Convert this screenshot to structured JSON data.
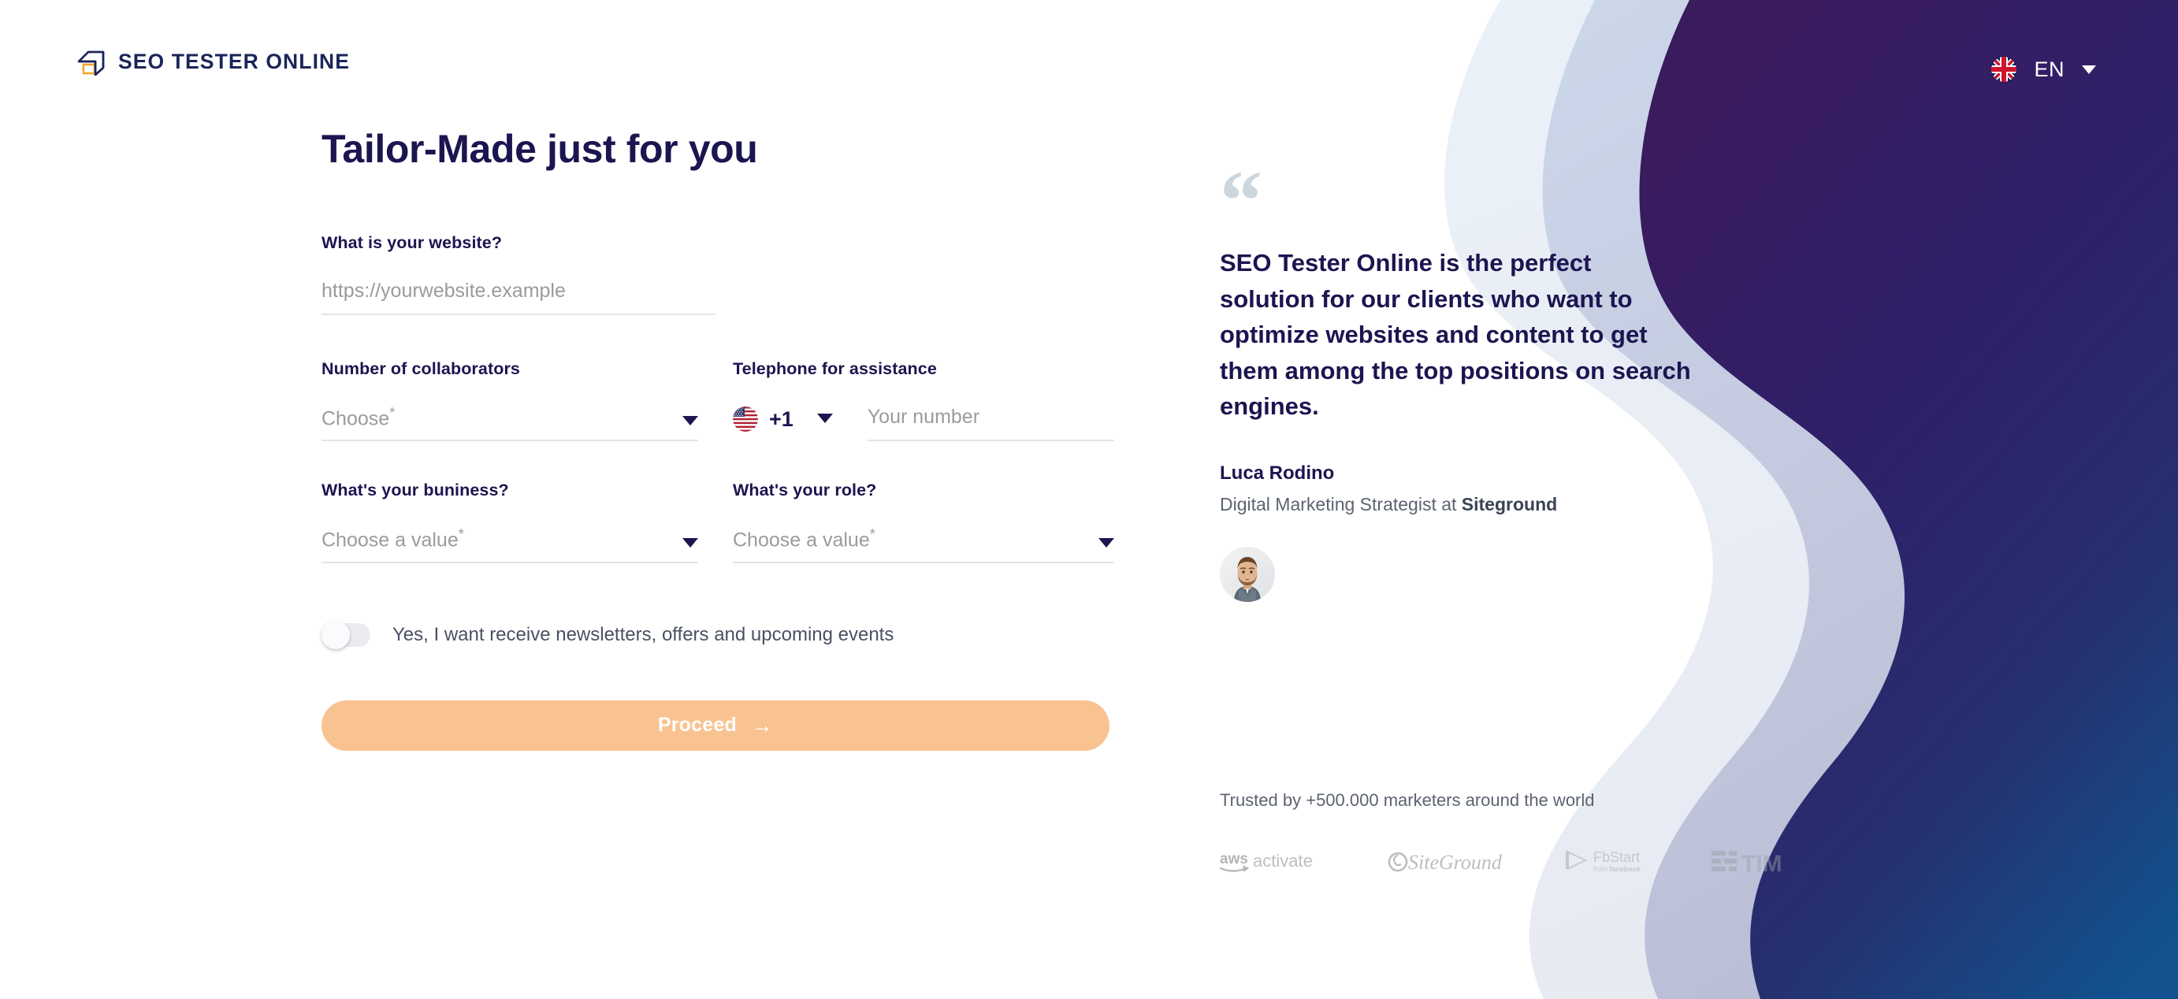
{
  "brand": {
    "logo_text": "SEO TESTER ONLINE",
    "logo_icon": "seo-cube-icon",
    "navy": "#1b1550",
    "accent": "#f9c391"
  },
  "header": {
    "language": {
      "code": "EN",
      "flag_icon": "uk-flag-icon",
      "caret_icon": "chevron-down-icon"
    }
  },
  "form": {
    "title": "Tailor-Made just for you",
    "website": {
      "label": "What is your website?",
      "placeholder": "https://yourwebsite.example",
      "value": ""
    },
    "collaborators": {
      "label": "Number of collaborators",
      "value": "Choose",
      "required_marker": "*",
      "caret_icon": "chevron-down-icon"
    },
    "telephone": {
      "label": "Telephone for assistance",
      "country_flag_icon": "us-flag-icon",
      "country_code": "+1",
      "caret_icon": "chevron-down-icon",
      "placeholder": "Your number",
      "value": ""
    },
    "business": {
      "label": "What's your buniness?",
      "value": "Choose a value",
      "required_marker": "*",
      "caret_icon": "chevron-down-icon"
    },
    "role": {
      "label": "What's your role?",
      "value": "Choose a value",
      "required_marker": "*",
      "caret_icon": "chevron-down-icon"
    },
    "newsletter": {
      "label": "Yes, I want receive newsletters, offers and upcoming events",
      "checked": false
    },
    "submit": {
      "label": "Proceed",
      "arrow_icon": "arrow-right-icon"
    }
  },
  "testimonial": {
    "quote_icon": "quote-mark-icon",
    "text": "SEO Tester Online is the perfect solution for our clients who want to optimize websites and content to get them among the top positions on search engines.",
    "author_name": "Luca Rodino",
    "author_role_prefix": "Digital Marketing Strategist at ",
    "author_company": "Siteground",
    "avatar_icon": "avatar-photo"
  },
  "trust": {
    "text": "Trusted by +500.000 marketers around the world",
    "logos": [
      {
        "name": "aws-activate-logo",
        "label": "aws activate"
      },
      {
        "name": "siteground-logo",
        "label": "SiteGround"
      },
      {
        "name": "fbstart-logo",
        "label": "FbStart"
      },
      {
        "name": "tim-logo",
        "label": "TIM"
      }
    ]
  }
}
